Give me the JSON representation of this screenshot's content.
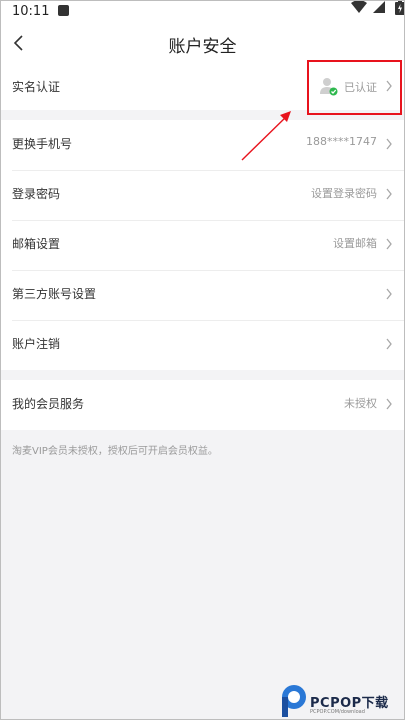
{
  "status_bar": {
    "time": "10:11"
  },
  "nav": {
    "title": "账户安全"
  },
  "rows": {
    "real_name": {
      "label": "实名认证",
      "value": "已认证"
    },
    "phone": {
      "label": "更换手机号",
      "value": "188****1747"
    },
    "password": {
      "label": "登录密码",
      "value": "设置登录密码"
    },
    "email": {
      "label": "邮箱设置",
      "value": "设置邮箱"
    },
    "third_party": {
      "label": "第三方账号设置"
    },
    "cancel": {
      "label": "账户注销"
    },
    "membership": {
      "label": "我的会员服务",
      "value": "未授权"
    }
  },
  "note": "淘麦VIP会员未授权，授权后可开启会员权益。",
  "watermark": {
    "brand": "PCPOP下载",
    "sub": "PCPOP.COM/download"
  },
  "colors": {
    "highlight": "#e8131d",
    "verified_check": "#2db84d"
  }
}
